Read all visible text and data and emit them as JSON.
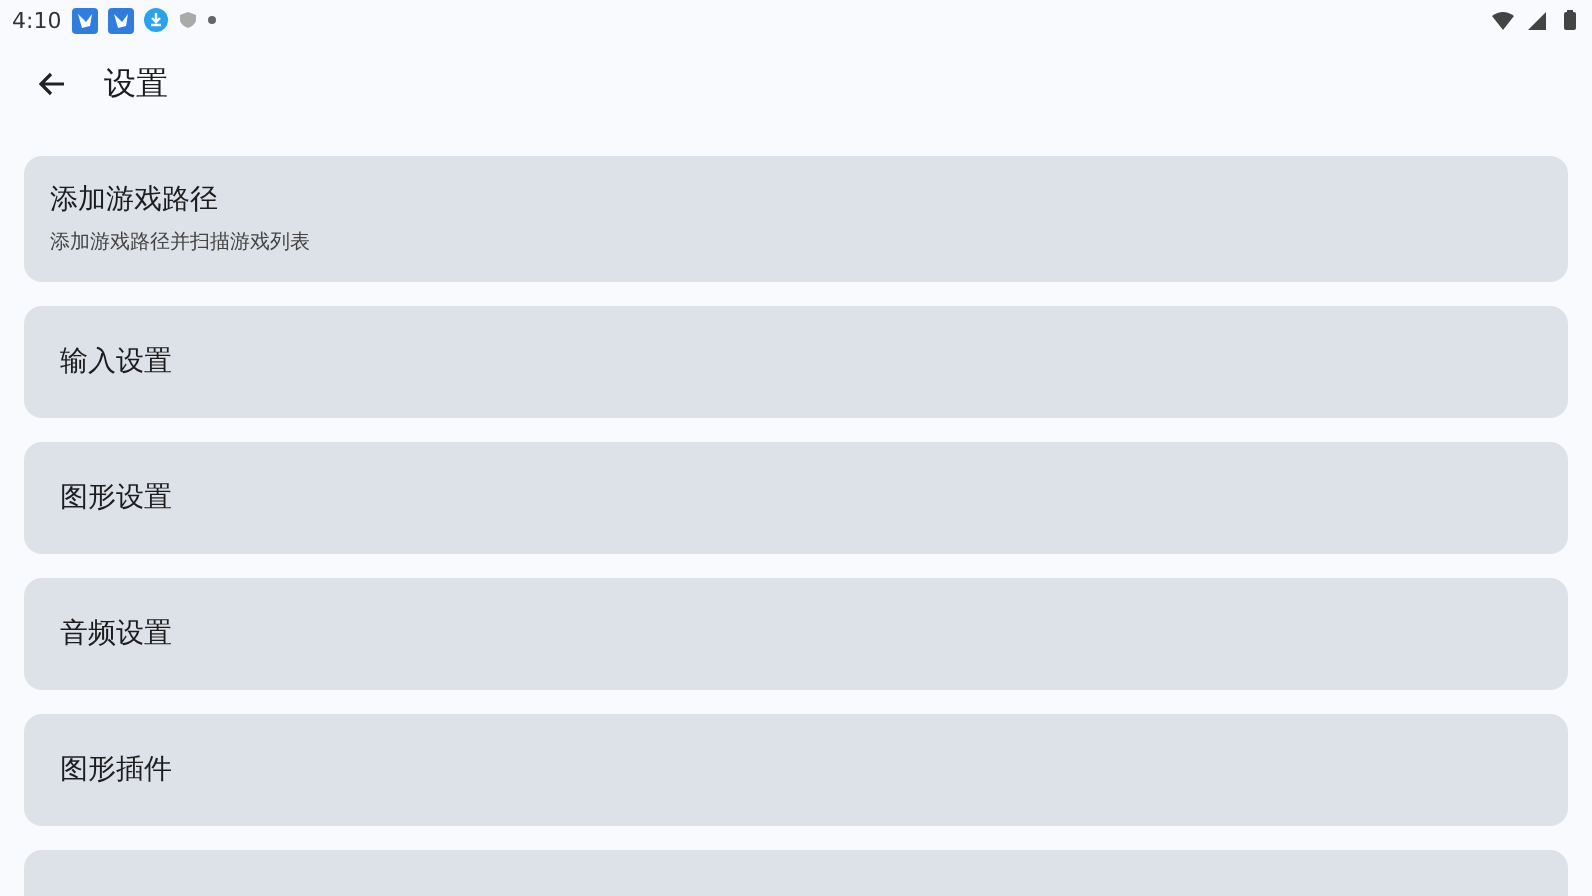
{
  "status_bar": {
    "time": "4:10"
  },
  "toolbar": {
    "title": "设置"
  },
  "items": [
    {
      "kind": "two_line",
      "title": "添加游戏路径",
      "subtitle": "添加游戏路径并扫描游戏列表"
    },
    {
      "kind": "one_line",
      "title": "输入设置"
    },
    {
      "kind": "one_line",
      "title": "图形设置"
    },
    {
      "kind": "one_line",
      "title": "音频设置"
    },
    {
      "kind": "one_line",
      "title": "图形插件"
    },
    {
      "kind": "cut"
    }
  ]
}
